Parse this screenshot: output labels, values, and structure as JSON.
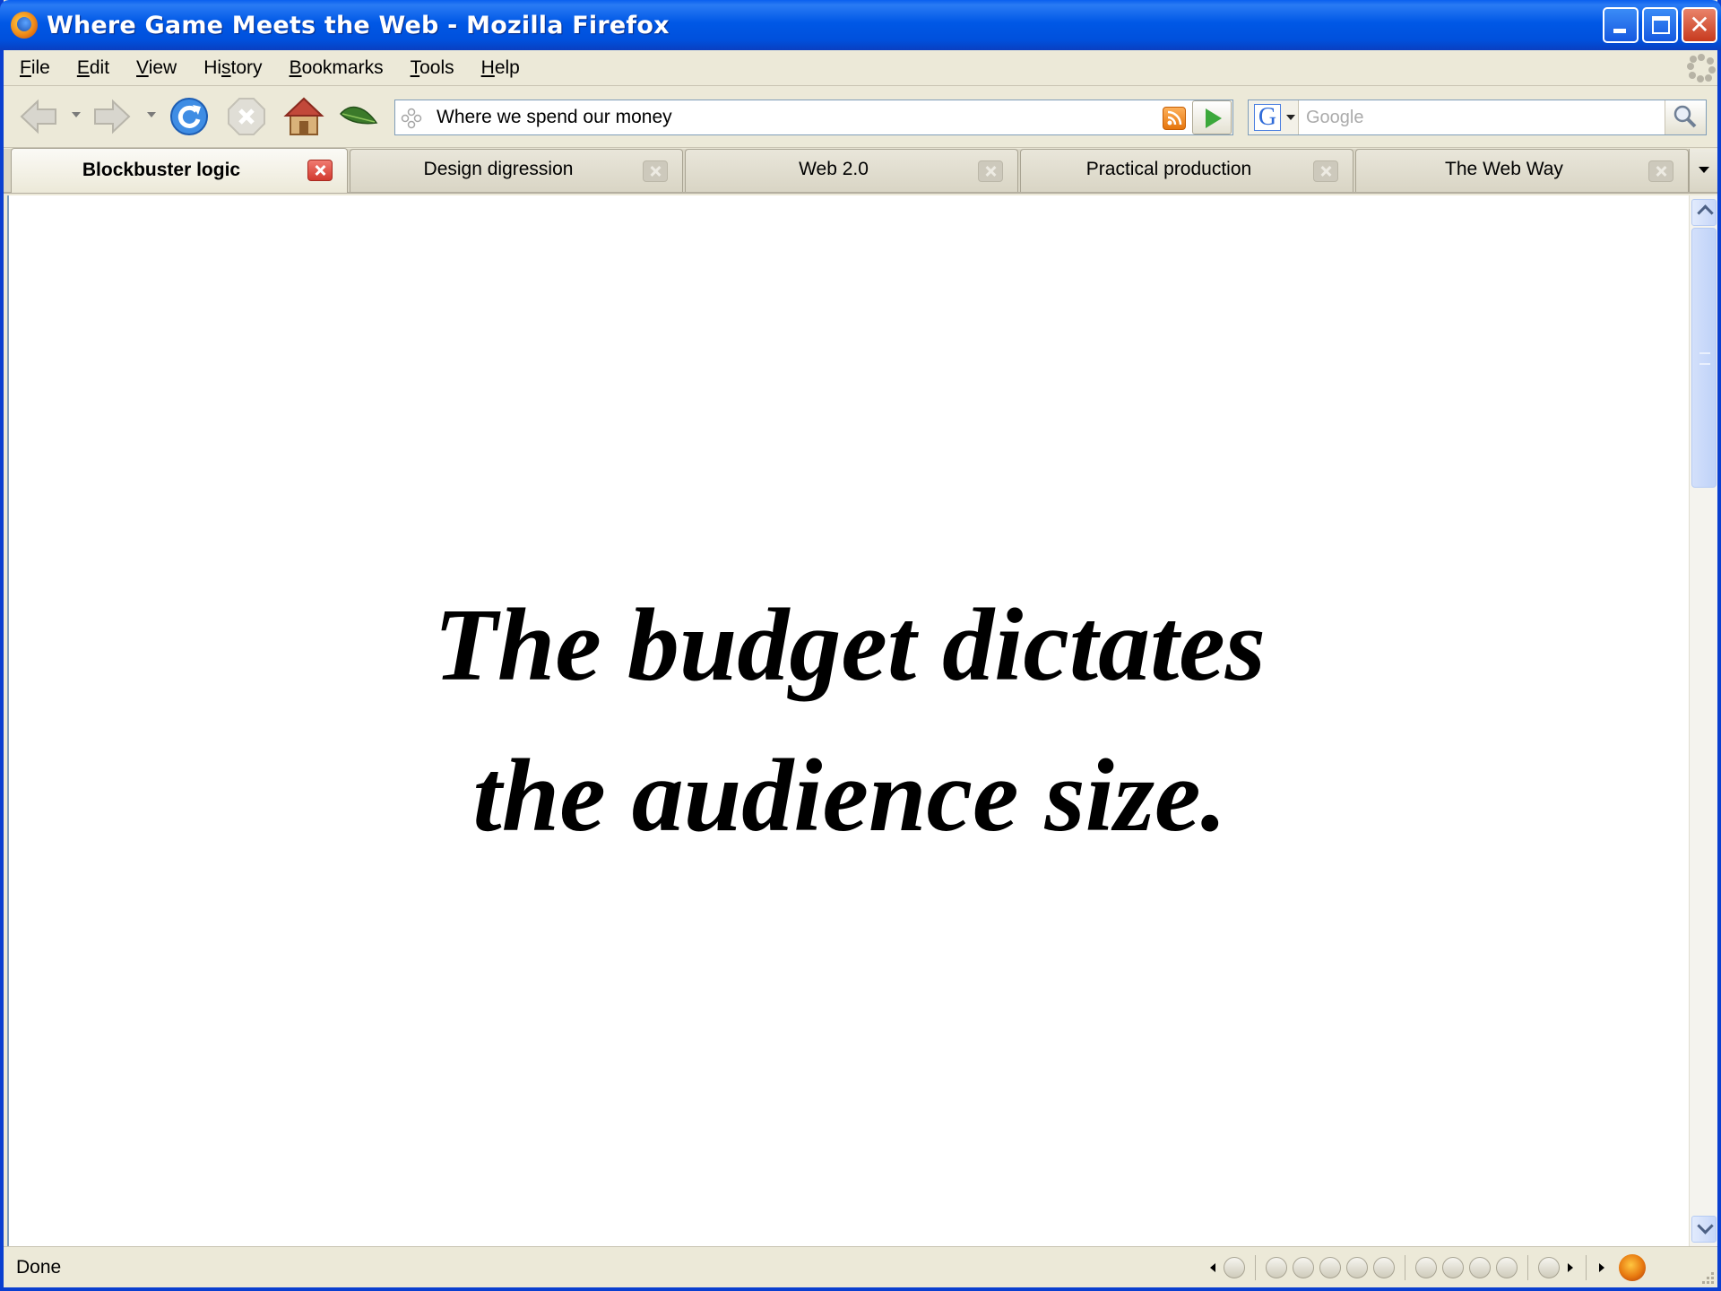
{
  "window": {
    "title": "Where Game Meets the Web - Mozilla Firefox",
    "app_icon": "firefox-icon",
    "controls": [
      "minimize-icon",
      "maximize-icon",
      "close-icon"
    ],
    "close_glyph": "✕"
  },
  "menubar": {
    "items": [
      {
        "accel": "F",
        "rest": "ile"
      },
      {
        "accel": "E",
        "rest": "dit"
      },
      {
        "accel": "V",
        "rest": "iew"
      },
      {
        "pre": "Hi",
        "accel": "s",
        "rest": "tory"
      },
      {
        "accel": "B",
        "rest": "ookmarks"
      },
      {
        "accel": "T",
        "rest": "ools"
      },
      {
        "accel": "H",
        "rest": "elp"
      }
    ]
  },
  "navbar": {
    "icons": [
      "back-icon",
      "forward-icon",
      "reload-icon",
      "stop-icon",
      "home-icon",
      "leaf-icon"
    ],
    "url": {
      "value": "Where we spend our money",
      "site_icon": "page-icon",
      "feed_icon": "rss-icon"
    },
    "search": {
      "engine": "Google",
      "engine_letter": "G",
      "placeholder": "Google",
      "button_icon": "magnifier-icon"
    }
  },
  "tabs": [
    {
      "label": "Blockbuster logic",
      "active": true
    },
    {
      "label": "Design digression",
      "active": false
    },
    {
      "label": "Web 2.0",
      "active": false
    },
    {
      "label": "Practical production",
      "active": false
    },
    {
      "label": "The Web Way",
      "active": false
    }
  ],
  "content": {
    "lines": [
      "The budget dictates",
      "the audience size."
    ]
  },
  "statusbar": {
    "text": "Done"
  },
  "colors": {
    "titlebar": "#0058E6",
    "chrome": "#ECE9D8",
    "active_tab_close": "#D23A2E",
    "feed": "#E6750C",
    "go": "#3BA83B"
  }
}
